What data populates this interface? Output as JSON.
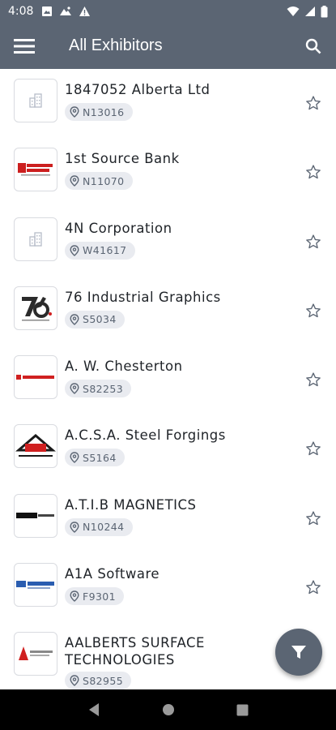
{
  "status_bar": {
    "time": "4:08"
  },
  "header": {
    "title": "All Exhibitors"
  },
  "colors": {
    "primary": "#5b6573",
    "chip_bg": "#e9ebf0",
    "text": "#1f2328"
  },
  "exhibitors": [
    {
      "name": "1847052 Alberta Ltd",
      "booth": "N13016",
      "logo": "building-placeholder-icon"
    },
    {
      "name": "1st Source Bank",
      "booth": "N11070",
      "logo": "1st-source-bank-logo"
    },
    {
      "name": "4N Corporation",
      "booth": "W41617",
      "logo": "building-placeholder-icon"
    },
    {
      "name": "76 Industrial Graphics",
      "booth": "S5034",
      "logo": "76-industrial-graphics-logo"
    },
    {
      "name": "A. W. Chesterton",
      "booth": "S82253",
      "logo": "chesterton-logo"
    },
    {
      "name": "A.C.S.A. Steel Forgings",
      "booth": "S5164",
      "logo": "acsa-logo"
    },
    {
      "name": "A.T.I.B MAGNETICS",
      "booth": "N10244",
      "logo": "atib-logo"
    },
    {
      "name": "A1A Software",
      "booth": "F9301",
      "logo": "a1a-software-logo"
    },
    {
      "name": "AALBERTS SURFACE TECHNOLOGIES",
      "booth": "S82955",
      "logo": "aalberts-logo"
    }
  ]
}
